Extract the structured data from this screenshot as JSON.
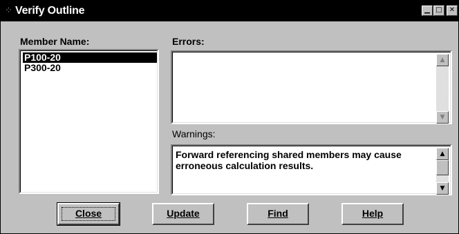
{
  "window": {
    "title": "Verify Outline",
    "controls": {
      "minimize": "▁",
      "maximize": "□",
      "close": "✕"
    }
  },
  "member_list": {
    "label": "Member Name:",
    "items": [
      "P100-20",
      "P300-20"
    ],
    "selected_index": 0
  },
  "errors": {
    "label": "Errors:",
    "text": ""
  },
  "warnings": {
    "label": "Warnings:",
    "text": "Forward referencing shared members may cause erroneous calculation results."
  },
  "buttons": {
    "close": "Close",
    "update": "Update",
    "find": "Find",
    "help": "Help"
  },
  "icons": {
    "scroll_up": "▲",
    "scroll_down": "▼",
    "app": "⁘"
  }
}
